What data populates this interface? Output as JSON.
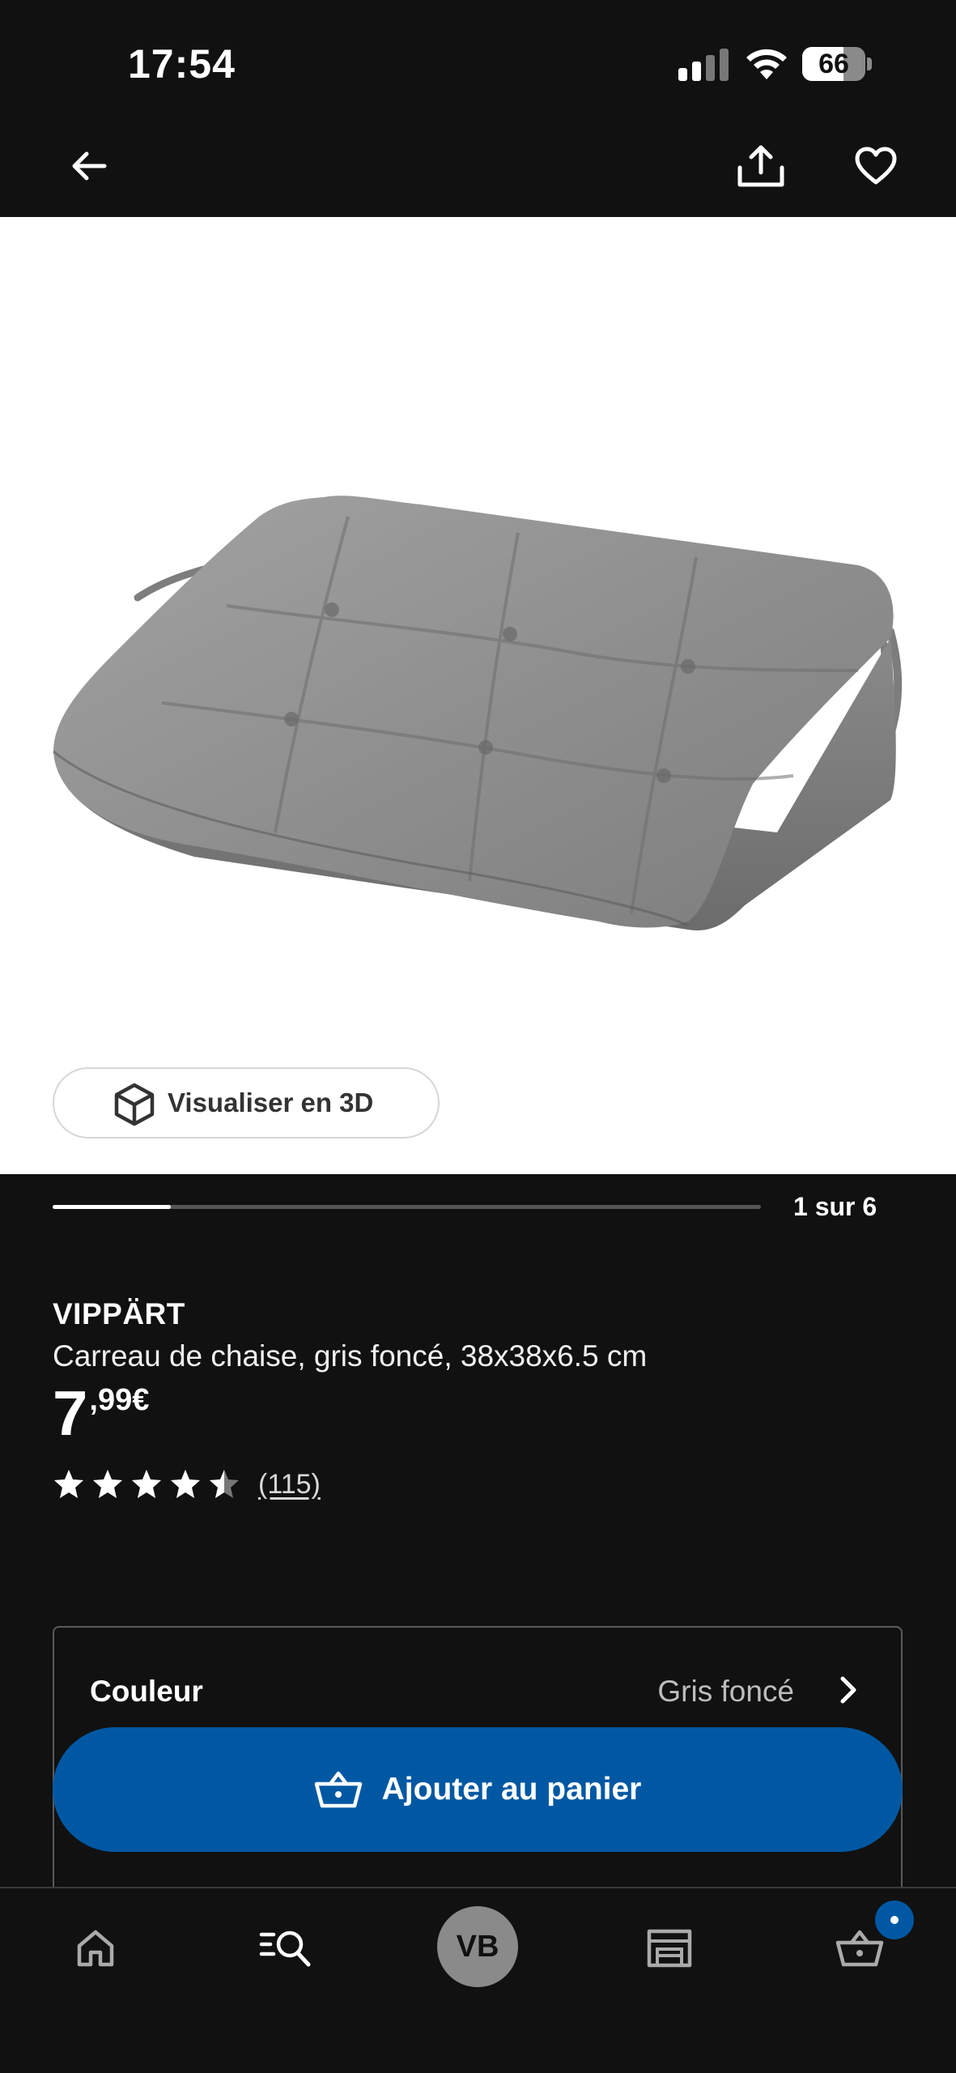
{
  "status_bar": {
    "time": "17:54",
    "battery_percent": "66",
    "battery_level": 0.66,
    "signal_bars_active": 2,
    "signal_bars_total": 4
  },
  "top_nav": {
    "back_icon": "arrow-left-icon",
    "share_icon": "share-icon",
    "favorite_icon": "heart-icon"
  },
  "media": {
    "view_3d_label": "Visualiser en 3D",
    "view_3d_icon": "cube-icon"
  },
  "gallery": {
    "counter": "1 sur 6",
    "current": 1,
    "total": 6
  },
  "product": {
    "name": "VIPPÄRT",
    "description": "Carreau de chaise, gris foncé, 38x38x6.5 cm",
    "price_integer": "7",
    "price_decimal": ",99€",
    "rating": 4.5,
    "rating_max": 5,
    "rating_count": "(115)"
  },
  "color_selector": {
    "label": "Couleur",
    "value": "Gris foncé",
    "chevron_icon": "chevron-right-icon"
  },
  "cart_button": {
    "label": "Ajouter au panier",
    "icon": "basket-icon"
  },
  "bottom_nav": {
    "home_icon": "home-icon",
    "search_icon": "search-icon",
    "profile_initials": "VB",
    "stores_icon": "store-icon",
    "cart_icon": "basket-icon"
  },
  "colors": {
    "background": "#111111",
    "accent": "#0058a3",
    "image_background": "#ffffff"
  }
}
